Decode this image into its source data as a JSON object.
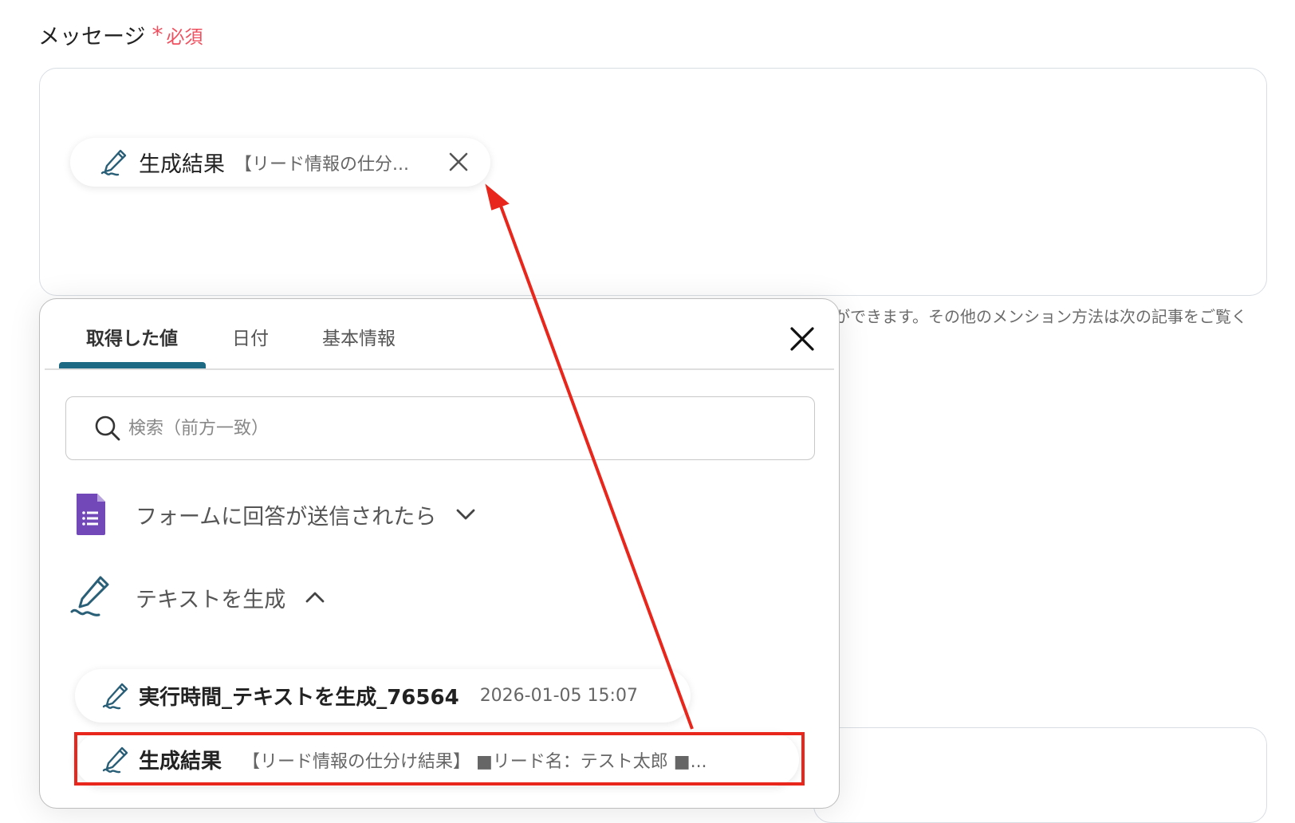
{
  "field": {
    "label": "メッセージ",
    "required_label": "必須",
    "required_mark": "*"
  },
  "chip": {
    "name": "生成結果",
    "value": "【リード情報の仕分...",
    "icon": "pen-signature-icon",
    "close_icon": "close-icon"
  },
  "hint_text": "ができます。その他のメンション方法は次の記事をご覧く",
  "panel": {
    "tabs": [
      {
        "label": "取得した値",
        "active": true
      },
      {
        "label": "日付",
        "active": false
      },
      {
        "label": "基本情報",
        "active": false
      }
    ],
    "search_placeholder": "検索（前方一致）",
    "groups": [
      {
        "title": "フォームに回答が送信されたら",
        "icon": "google-forms-icon",
        "expanded": false,
        "chevron": "chevron-down-icon"
      },
      {
        "title": "テキストを生成",
        "icon": "pen-signature-icon",
        "expanded": true,
        "chevron": "chevron-up-icon"
      }
    ],
    "items": [
      {
        "name": "実行時間_テキストを生成_76564",
        "value": "2026-01-05 15:07"
      },
      {
        "name": "生成結果",
        "value": "【リード情報の仕分け結果】 ■リード名：テスト太郎 ■..."
      }
    ]
  },
  "colors": {
    "accent": "#1c6a84",
    "required": "#ef4f5e",
    "annotation": "#e8261b",
    "forms_purple": "#7248b9"
  }
}
